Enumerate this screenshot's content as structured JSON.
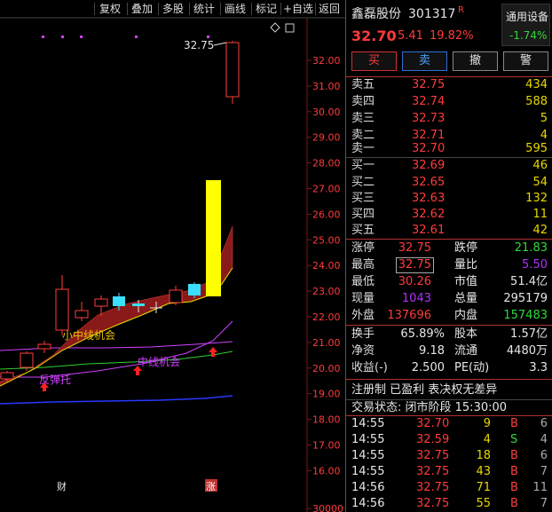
{
  "toolbar": {
    "items": [
      "复权",
      "叠加",
      "多股",
      "统计",
      "画线",
      "标记",
      "+自选",
      "返回"
    ]
  },
  "chart": {
    "price_labels": [
      "32.00",
      "31.00",
      "30.00",
      "29.00",
      "28.00",
      "27.00",
      "26.00",
      "25.00",
      "24.00",
      "23.00",
      "22.00",
      "21.00",
      "20.00",
      "19.00",
      "18.00",
      "17.00",
      "16.00",
      "30000"
    ],
    "high_label": "32.75",
    "annotations": {
      "small_mid_line": "小中线机会",
      "mid_line": "中线机会",
      "rebound": "反弹托"
    },
    "bottom_markers": {
      "cai": "财",
      "zhang": "涨"
    },
    "colors": {
      "up": "#ff3b3b",
      "flat_candle": "#39e0ff",
      "yellow_bar": "#ffff00",
      "band": "#a01818",
      "yellow_line": "#e8e000",
      "green_line": "#30d030",
      "magenta_line": "#d040ff",
      "blue_line": "#2838ff",
      "pink_line": "#ff5090"
    }
  },
  "header": {
    "name": "鑫磊股份",
    "code": "301317",
    "badge": "R",
    "device": "通用设备",
    "price": "32.70",
    "change": "5.41",
    "change_pct": "19.82%",
    "device_pct": "-1.74%"
  },
  "trade_buttons": [
    "买",
    "卖",
    "撤",
    "警"
  ],
  "asks": [
    {
      "label": "卖五",
      "price": "32.75",
      "vol": "434"
    },
    {
      "label": "卖四",
      "price": "32.74",
      "vol": "588"
    },
    {
      "label": "卖三",
      "price": "32.73",
      "vol": "5"
    },
    {
      "label": "卖二",
      "price": "32.71",
      "vol": "4"
    },
    {
      "label": "卖一",
      "price": "32.70",
      "vol": "595"
    }
  ],
  "bids": [
    {
      "label": "买一",
      "price": "32.69",
      "vol": "46"
    },
    {
      "label": "买二",
      "price": "32.65",
      "vol": "54"
    },
    {
      "label": "买三",
      "price": "32.63",
      "vol": "132"
    },
    {
      "label": "买四",
      "price": "32.62",
      "vol": "11"
    },
    {
      "label": "买五",
      "price": "32.61",
      "vol": "42"
    }
  ],
  "stats1": {
    "zhangting_l": "涨停",
    "zhangting": "32.75",
    "dieting_l": "跌停",
    "dieting": "21.83",
    "zuigao_l": "最高",
    "zuigao": "32.75",
    "liangbi_l": "量比",
    "liangbi": "5.50",
    "zuidi_l": "最低",
    "zuidi": "30.26",
    "shizhi_l": "市值",
    "shizhi": "51.4亿",
    "xianliang_l": "现量",
    "xianliang": "1043",
    "zongliang_l": "总量",
    "zongliang": "295179",
    "waipan_l": "外盘",
    "waipan": "137696",
    "neipan_l": "内盘",
    "neipan": "157483"
  },
  "stats2": {
    "huanshou_l": "换手",
    "huanshou": "65.89%",
    "guben_l": "股本",
    "guben": "1.57亿",
    "jingzi_l": "净资",
    "jingzi": "9.18",
    "liutong_l": "流通",
    "liutong": "4480万",
    "shouyi_l": "收益(-)",
    "shouyi": "2.500",
    "pe_l": "PE(动)",
    "pe": "3.3"
  },
  "info_line": "注册制 已盈利 表决权无差异",
  "status_line": "交易状态: 闭市阶段 15:30:00",
  "trades": [
    {
      "time": "14:55",
      "price": "32.70",
      "vol": "9",
      "bs": "B",
      "n": "6"
    },
    {
      "time": "14:55",
      "price": "32.59",
      "vol": "4",
      "bs": "S",
      "n": "4"
    },
    {
      "time": "14:55",
      "price": "32.75",
      "vol": "18",
      "bs": "B",
      "n": "6"
    },
    {
      "time": "14:55",
      "price": "32.75",
      "vol": "43",
      "bs": "B",
      "n": "7"
    },
    {
      "time": "14:56",
      "price": "32.75",
      "vol": "71",
      "bs": "B",
      "n": "11"
    },
    {
      "time": "14:56",
      "price": "32.75",
      "vol": "55",
      "bs": "B",
      "n": "7"
    }
  ]
}
